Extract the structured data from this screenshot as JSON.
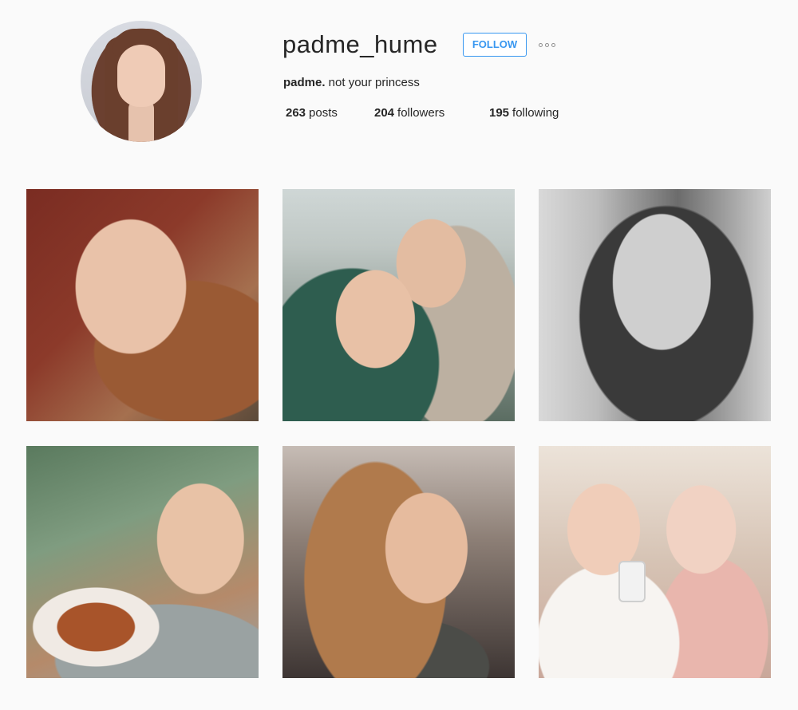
{
  "profile": {
    "username": "padme_hume",
    "follow_label": "FOLLOW",
    "more_icon": "more-options-icon",
    "bio_name": "padme.",
    "bio_text": " not your princess",
    "stats": {
      "posts_count": "263",
      "posts_label": "posts",
      "followers_count": "204",
      "followers_label": "followers",
      "following_count": "195",
      "following_label": "following"
    }
  },
  "colors": {
    "background": "#fafafa",
    "accent": "#3897f0",
    "text": "#262626"
  }
}
